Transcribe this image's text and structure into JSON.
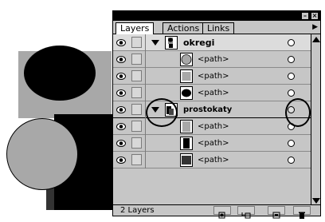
{
  "panel": {
    "tabs": [
      {
        "label": "Layers",
        "active": true
      },
      {
        "label": "Actions",
        "active": false
      },
      {
        "label": "Links",
        "active": false
      }
    ],
    "layers": [
      {
        "name": "okregi",
        "type": "layer",
        "expanded": true,
        "selected": true,
        "thumb": "group"
      },
      {
        "name": "<path>",
        "type": "path",
        "thumb": "gray-circle"
      },
      {
        "name": "<path>",
        "type": "path",
        "thumb": "gray-square"
      },
      {
        "name": "<path>",
        "type": "path",
        "thumb": "black-ellipse"
      },
      {
        "name": "prostokaty",
        "type": "layer",
        "expanded": true,
        "selected": false,
        "thumb": "rect-group"
      },
      {
        "name": "<path>",
        "type": "path",
        "thumb": "gray-rect"
      },
      {
        "name": "<path>",
        "type": "path",
        "thumb": "black-rect"
      },
      {
        "name": "<path>",
        "type": "path",
        "thumb": "dark-rect"
      }
    ],
    "status": "2 Layers"
  },
  "colors": {
    "panel_bg": "#c6c6c6",
    "artwork_gray": "#a8a8a8",
    "artwork_black": "#000000",
    "artwork_dark": "#333333"
  }
}
